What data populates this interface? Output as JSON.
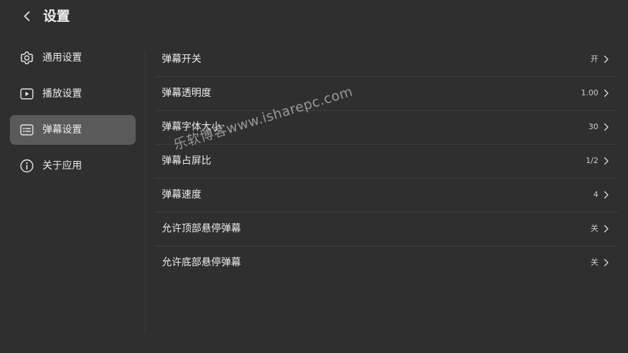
{
  "header": {
    "title": "设置"
  },
  "sidebar": {
    "items": [
      {
        "label": "通用设置",
        "icon": "gear-icon"
      },
      {
        "label": "播放设置",
        "icon": "play-icon"
      },
      {
        "label": "弹幕设置",
        "icon": "danmaku-icon",
        "active": true
      },
      {
        "label": "关于应用",
        "icon": "info-icon"
      }
    ]
  },
  "settings": [
    {
      "label": "弹幕开关",
      "value": "开"
    },
    {
      "label": "弹幕透明度",
      "value": "1.00"
    },
    {
      "label": "弹幕字体大小",
      "value": "30"
    },
    {
      "label": "弹幕占屏比",
      "value": "1/2"
    },
    {
      "label": "弹幕速度",
      "value": "4"
    },
    {
      "label": "允许顶部悬停弹幕",
      "value": "关"
    },
    {
      "label": "允许底部悬停弹幕",
      "value": "关"
    }
  ],
  "watermark": "乐软博客www.isharepc.com",
  "colors": {
    "background": "#2f2f2f",
    "active_item": "#5a5a5a",
    "text": "#ececec"
  }
}
